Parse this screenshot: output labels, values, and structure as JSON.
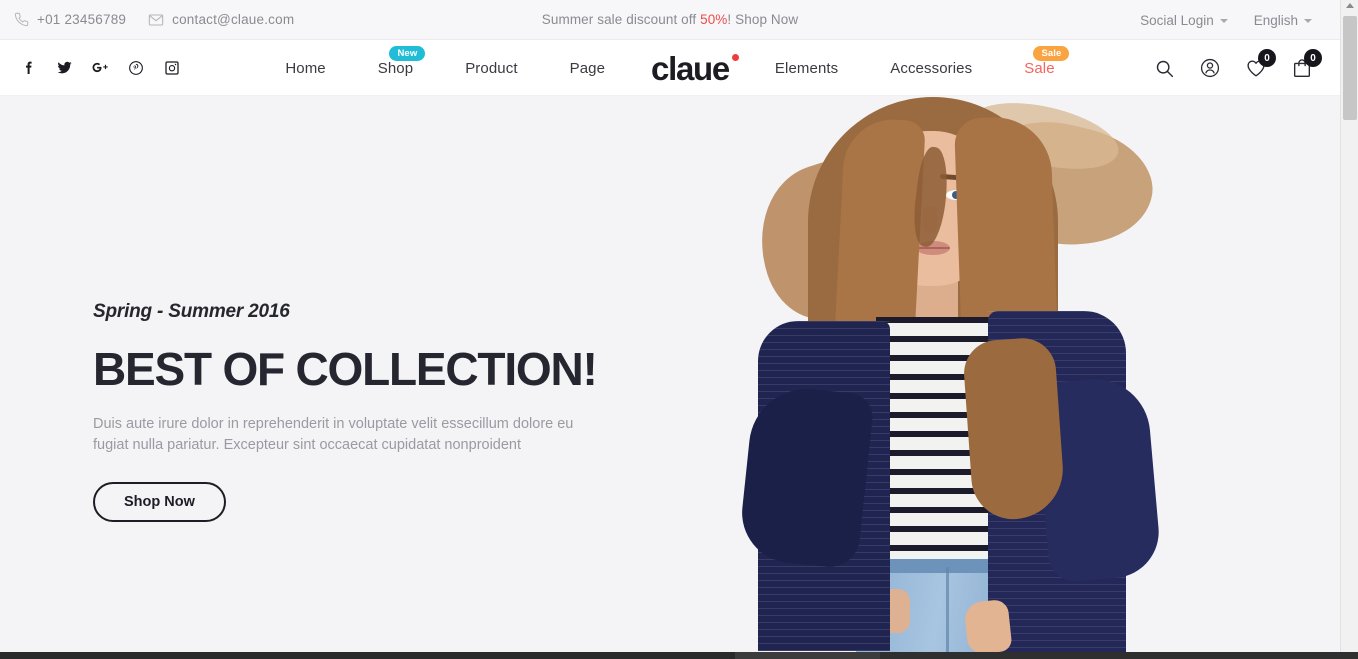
{
  "topbar": {
    "phone": "+01 23456789",
    "phone_icon": "phone-icon",
    "email": "contact@claue.com",
    "email_icon": "envelope-icon",
    "promo_prefix": "Summer sale discount off ",
    "promo_highlight": "50%",
    "promo_suffix": "! Shop Now",
    "social_login": "Social Login",
    "language": "English"
  },
  "social": [
    {
      "name": "facebook-icon",
      "glyph": "f"
    },
    {
      "name": "twitter-icon",
      "glyph": "t"
    },
    {
      "name": "googleplus-icon",
      "glyph": "G+"
    },
    {
      "name": "pinterest-icon",
      "glyph": "P"
    },
    {
      "name": "instagram-icon",
      "glyph": "ig"
    }
  ],
  "nav": {
    "items": [
      {
        "label": "Home",
        "badge": "",
        "highlight": false
      },
      {
        "label": "Shop",
        "badge": "New",
        "highlight": false
      },
      {
        "label": "Product",
        "badge": "",
        "highlight": false
      },
      {
        "label": "Page",
        "badge": "",
        "highlight": false
      }
    ],
    "items_right": [
      {
        "label": "Elements",
        "badge": "",
        "highlight": false
      },
      {
        "label": "Accessories",
        "badge": "",
        "highlight": false
      },
      {
        "label": "Sale",
        "badge": "Sale",
        "highlight": true
      }
    ],
    "logo": "claue"
  },
  "header_icons": {
    "search": "search-icon",
    "account": "account-icon",
    "wishlist_count": "0",
    "cart_count": "0"
  },
  "hero": {
    "eyebrow": "Spring - Summer 2016",
    "headline": "BEST OF COLLECTION!",
    "paragraph": "Duis aute irure dolor in reprehenderit in voluptate velit essecillum dolore eu fugiat nulla pariatur. Excepteur sint occaecat cupidatat nonproident",
    "button": "Shop Now"
  },
  "colors": {
    "accent_red": "#ee4b4b",
    "sale_text": "#f4655f",
    "badge_new": "#21bdd6",
    "badge_sale": "#f9a341",
    "logo_dot": "#ee3b3b",
    "hero_bg": "#f4f4f7",
    "topbar_bg": "#f7f7f9",
    "text_dark": "#262630",
    "text_muted": "#8a8a92"
  }
}
